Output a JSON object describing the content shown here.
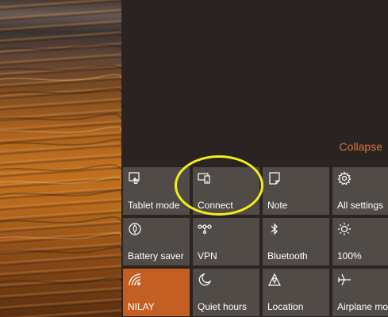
{
  "action_center": {
    "collapse_label": "Collapse",
    "accent_color": "#c35f23",
    "tile_color": "#514b47",
    "quick_actions": [
      {
        "label": "Tablet mode",
        "icon": "tablet-mode-icon",
        "active": false
      },
      {
        "label": "Connect",
        "icon": "connect-icon",
        "active": false
      },
      {
        "label": "Note",
        "icon": "note-icon",
        "active": false
      },
      {
        "label": "All settings",
        "icon": "gear-icon",
        "active": false
      },
      {
        "label": "Battery saver",
        "icon": "battery-saver-icon",
        "active": false
      },
      {
        "label": "VPN",
        "icon": "vpn-icon",
        "active": false
      },
      {
        "label": "Bluetooth",
        "icon": "bluetooth-icon",
        "active": false
      },
      {
        "label": "100%",
        "icon": "brightness-icon",
        "active": false
      },
      {
        "label": "NILAY",
        "icon": "wifi-icon",
        "active": true
      },
      {
        "label": "Quiet hours",
        "icon": "moon-icon",
        "active": false
      },
      {
        "label": "Location",
        "icon": "location-icon",
        "active": false
      },
      {
        "label": "Airplane mode",
        "icon": "airplane-icon",
        "active": false
      }
    ]
  },
  "annotation": {
    "highlight_color": "#f4ee1a",
    "highlighted_tile": "Connect"
  }
}
